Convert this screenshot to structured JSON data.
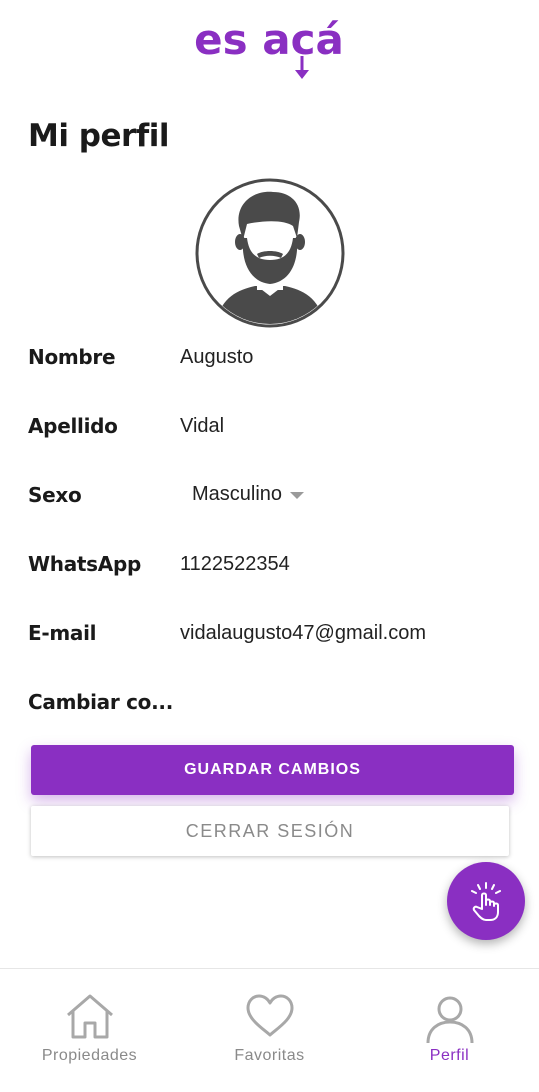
{
  "brand": {
    "logo_text": "es acá",
    "accent": "#8a2fc2"
  },
  "page": {
    "title": "Mi perfil"
  },
  "profile": {
    "fields": {
      "nombre": {
        "label": "Nombre",
        "value": "Augusto"
      },
      "apellido": {
        "label": "Apellido",
        "value": "Vidal"
      },
      "sexo": {
        "label": "Sexo",
        "value": "Masculino"
      },
      "whatsapp": {
        "label": "WhatsApp",
        "value": "1122522354"
      },
      "email": {
        "label": "E-mail",
        "value": "vidalaugusto47@gmail.com"
      },
      "password": {
        "label": "Cambiar co..."
      }
    }
  },
  "actions": {
    "save_label": "GUARDAR CAMBIOS",
    "logout_label": "CERRAR SESIÓN",
    "fab_icon": "tap-hand-icon"
  },
  "bottom_nav": {
    "items": [
      {
        "label": "Propiedades",
        "icon": "house-icon",
        "active": false
      },
      {
        "label": "Favoritas",
        "icon": "heart-icon",
        "active": false
      },
      {
        "label": "Perfil",
        "icon": "user-icon",
        "active": true
      }
    ]
  }
}
